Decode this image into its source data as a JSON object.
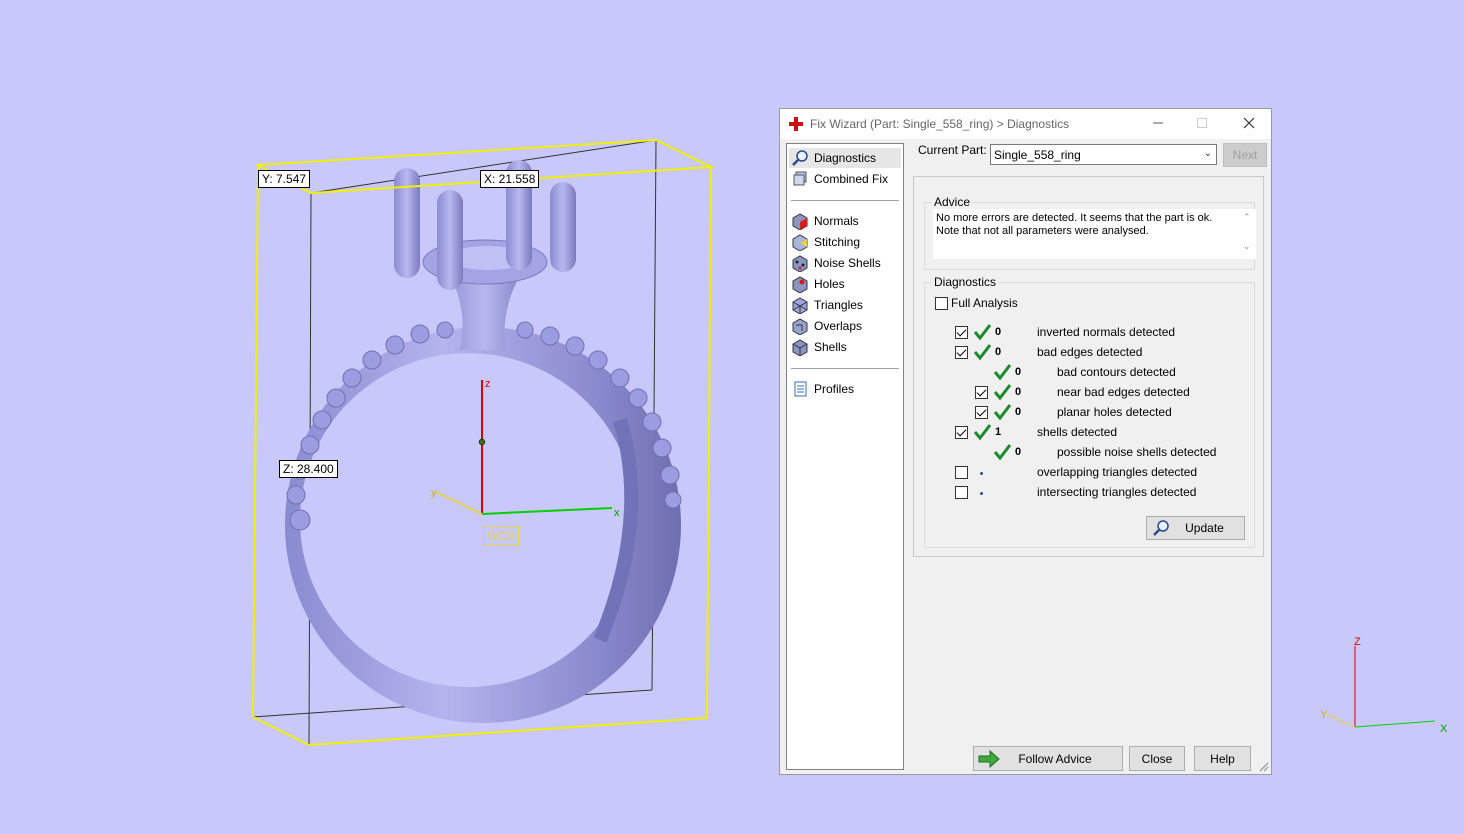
{
  "viewport": {
    "dim_y": "Y: 7.547",
    "dim_x": "X: 21.558",
    "dim_z": "Z: 28.400",
    "wcs_label": "WCS",
    "axis_z": "z",
    "axis_x": "x",
    "axis_y": "y",
    "corner_axis_z": "Z",
    "corner_axis_x": "X",
    "corner_axis_y": "Y",
    "colors": {
      "background": "#c8c8fa",
      "bbox": "#f0f000",
      "model": "#a0a0dc",
      "axis_z": "#e00000",
      "axis_x": "#00d000",
      "axis_y": "#e6d24a"
    }
  },
  "dialog": {
    "title": "Fix Wizard (Part: Single_558_ring) > Diagnostics",
    "title_icon": "red-cross-icon",
    "nav": {
      "group1": [
        {
          "label": "Diagnostics",
          "icon": "magnifier-icon",
          "selected": true
        },
        {
          "label": "Combined Fix",
          "icon": "combined-fix-icon"
        }
      ],
      "group2": [
        {
          "label": "Normals",
          "icon": "normals-icon"
        },
        {
          "label": "Stitching",
          "icon": "stitching-icon"
        },
        {
          "label": "Noise Shells",
          "icon": "noise-shells-icon"
        },
        {
          "label": "Holes",
          "icon": "holes-icon"
        },
        {
          "label": "Triangles",
          "icon": "triangles-icon"
        },
        {
          "label": "Overlaps",
          "icon": "overlaps-icon"
        },
        {
          "label": "Shells",
          "icon": "shells-icon"
        }
      ],
      "group3": [
        {
          "label": "Profiles",
          "icon": "profiles-icon"
        }
      ]
    },
    "current_part_label": "Current Part:",
    "current_part_value": "Single_558_ring",
    "next_label": "Next",
    "advice": {
      "title": "Advice",
      "text": "No more errors are detected. It seems that the part is ok. Note that not all parameters were analysed."
    },
    "diagnostics": {
      "title": "Diagnostics",
      "full_analysis_label": "Full Analysis",
      "full_analysis_checked": false,
      "rows": [
        {
          "checkbox": true,
          "checked": true,
          "status": "ok",
          "count": "0",
          "label": "inverted normals detected",
          "indent": 0
        },
        {
          "checkbox": true,
          "checked": true,
          "status": "ok",
          "count": "0",
          "label": "bad edges detected",
          "indent": 0
        },
        {
          "checkbox": false,
          "checked": false,
          "status": "ok",
          "count": "0",
          "label": "bad contours detected",
          "indent": 1
        },
        {
          "checkbox": true,
          "checked": true,
          "status": "ok",
          "count": "0",
          "label": "near bad edges detected",
          "indent": 1
        },
        {
          "checkbox": true,
          "checked": true,
          "status": "ok",
          "count": "0",
          "label": "planar holes detected",
          "indent": 1
        },
        {
          "checkbox": true,
          "checked": true,
          "status": "ok",
          "count": "1",
          "label": "shells detected",
          "indent": 0
        },
        {
          "checkbox": false,
          "checked": false,
          "status": "ok",
          "count": "0",
          "label": "possible noise shells detected",
          "indent": 1
        },
        {
          "checkbox": true,
          "checked": false,
          "status": "not-analysed",
          "count": "",
          "label": "overlapping triangles detected",
          "indent": 0
        },
        {
          "checkbox": true,
          "checked": false,
          "status": "not-analysed",
          "count": "",
          "label": "intersecting triangles detected",
          "indent": 0
        }
      ],
      "update_label": "Update"
    },
    "follow_advice_label": "Follow Advice",
    "close_label": "Close",
    "help_label": "Help"
  }
}
